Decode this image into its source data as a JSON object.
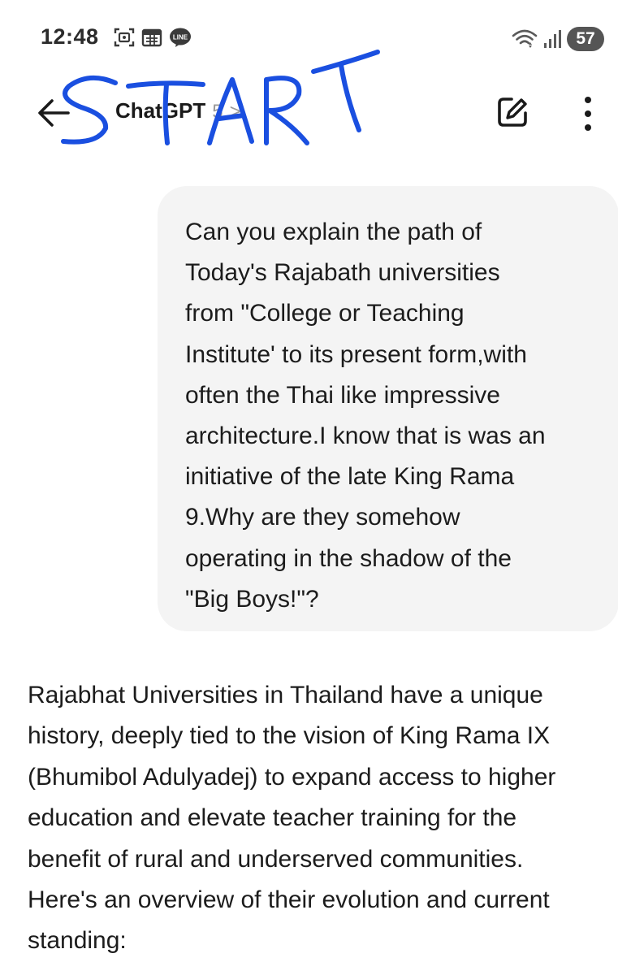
{
  "status_bar": {
    "time": "12:48",
    "left_icons": [
      "screenshot-icon",
      "calendar-icon",
      "line-app-icon"
    ],
    "line_badge_text": "LINE",
    "right_icons": [
      "wifi-icon",
      "cellular-signal-icon"
    ],
    "battery_level": "57"
  },
  "header": {
    "title": "ChatGPT",
    "version": "5",
    "chevron": ">",
    "handwritten_annotation": "START",
    "annotation_color": "#1a4fe0"
  },
  "conversation": {
    "user_message": "Can you explain the path of\nToday's Rajabath universities\nfrom \"College or Teaching\nInstitute' to its present form,with\noften the Thai like impressive\narchitecture.I know that is was an\ninitiative of the late King Rama\n9.Why are they somehow\noperating in the shadow of the\n\"Big Boys!\"?",
    "assistant_message": "Rajabhat Universities in Thailand have a unique\nhistory, deeply tied to the vision of King Rama IX\n(Bhumibol Adulyadej) to expand access to higher\neducation and elevate teacher training for the\nbenefit of rural and underserved communities.\nHere's an overview of their evolution and current\nstanding:"
  },
  "colors": {
    "user_bubble_bg": "#f4f4f4",
    "text": "#1c1c1c",
    "battery_bg": "#555555"
  }
}
